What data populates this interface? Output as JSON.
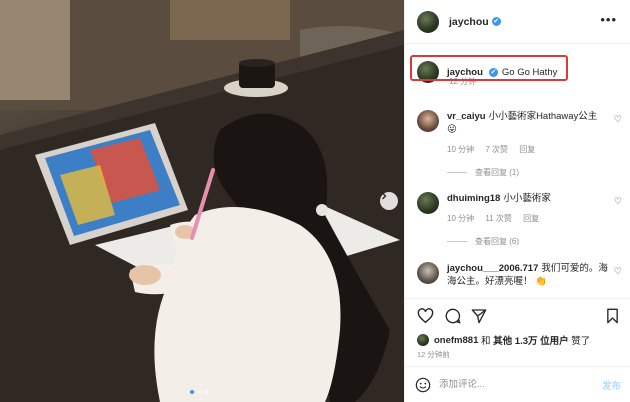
{
  "post": {
    "username": "jaychou",
    "verified_mark": "✔",
    "more_icon": "more-horizontal-icon"
  },
  "caption": {
    "username": "jaychou",
    "text": "Go Go Hathy",
    "time": "12 分钟"
  },
  "comments": [
    {
      "username": "vr_caiyu",
      "text": "小小藝術家Hathaway公主",
      "emoji": "😜",
      "time": "10 分钟",
      "likes": "7 次赞",
      "reply": "回复",
      "view_replies": "查看回复 (1)"
    },
    {
      "username": "dhuiming18",
      "text": "小小藝術家",
      "time": "10 分钟",
      "likes": "11 次赞",
      "reply": "回复",
      "view_replies": "查看回复 (6)"
    },
    {
      "username": "jaychou___2006.717",
      "text": "我们可爱的。海海公主。好漂亮喔！",
      "emoji": "👏"
    }
  ],
  "likes": {
    "user": "onefm881",
    "connector": "和",
    "others": "其他 1.3万 位用户",
    "suffix": "赞了"
  },
  "post_time": "12 分钟前",
  "composer": {
    "placeholder": "添加评论...",
    "post_label": "发布"
  },
  "colors": {
    "accent": "#3897f0",
    "highlight_box": "#d93b3b",
    "post_disabled": "#b2dffc"
  }
}
